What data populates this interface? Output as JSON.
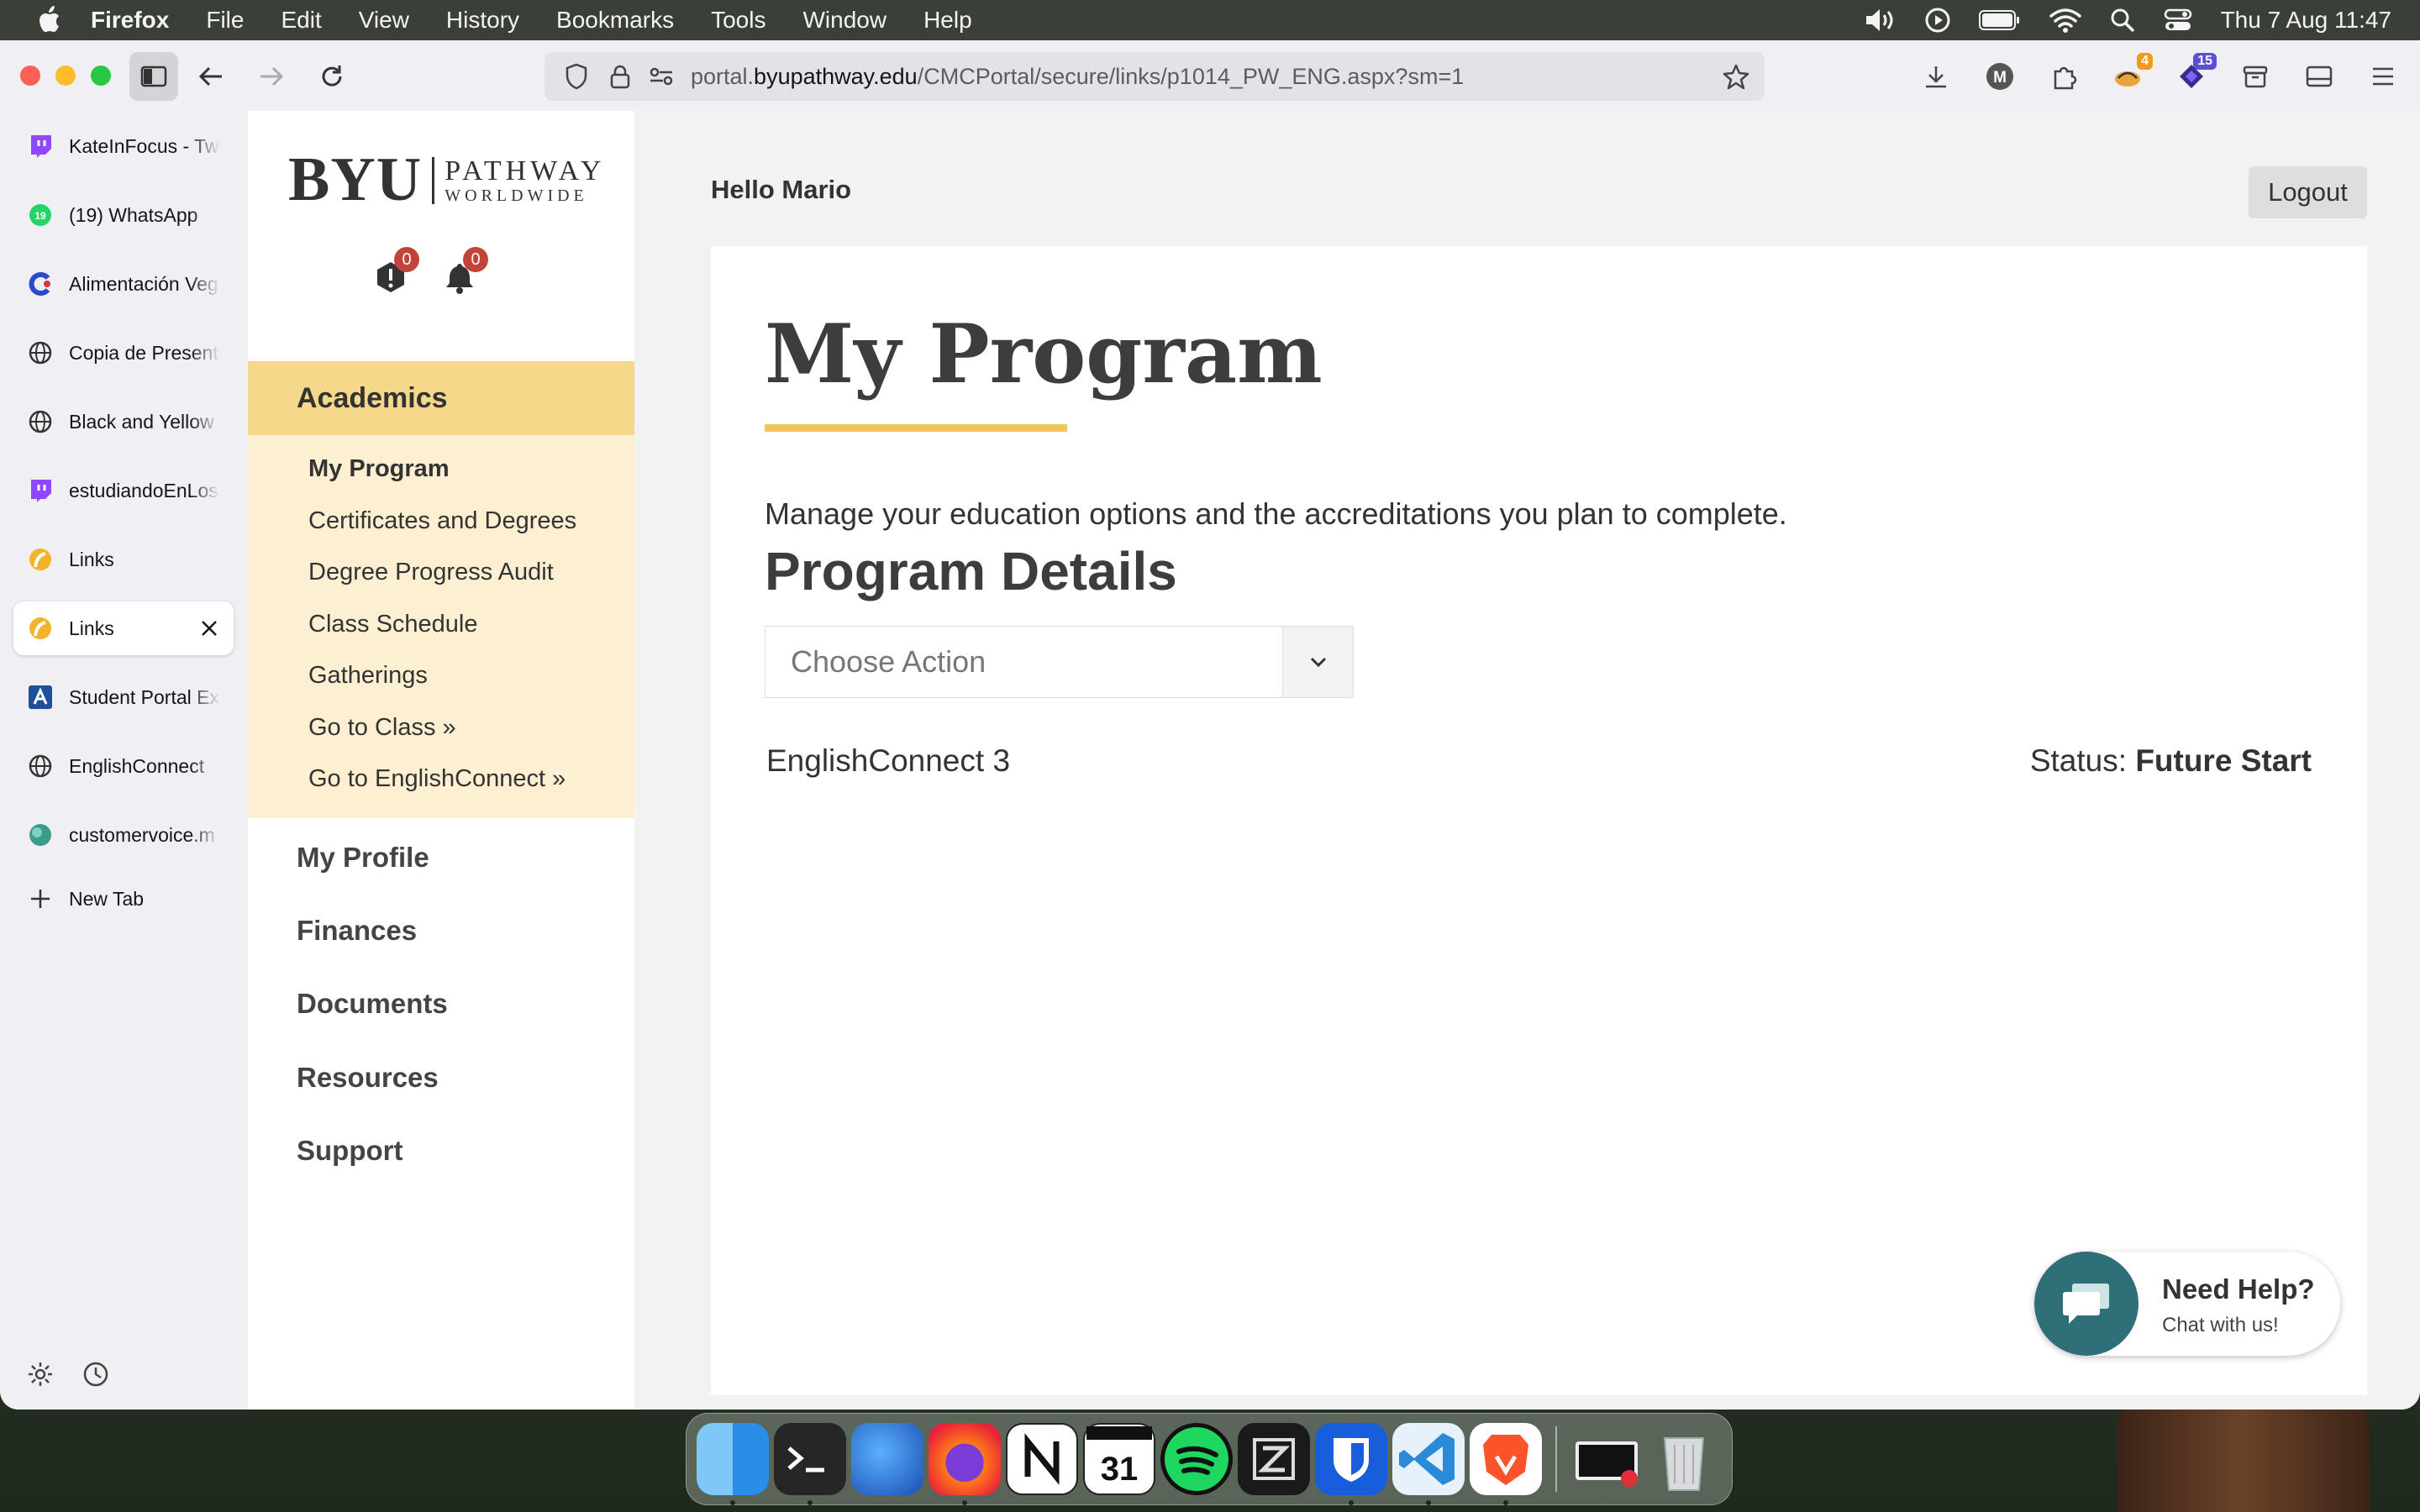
{
  "menubar": {
    "app_name": "Firefox",
    "items": [
      "File",
      "Edit",
      "View",
      "History",
      "Bookmarks",
      "Tools",
      "Window",
      "Help"
    ],
    "clock": "Thu 7 Aug  11:47"
  },
  "browser": {
    "url_prefix": "portal.",
    "url_host": "byupathway.edu",
    "url_path": "/CMCPortal/secure/links/p1014_PW_ENG.aspx?sm=1",
    "badge_extension_1": "4",
    "badge_extension_2": "15",
    "account_initial": "M"
  },
  "tabs": [
    {
      "label": "KateInFocus - Tw",
      "icon": "twitch-icon",
      "color": "#9146ff"
    },
    {
      "label": "(19) WhatsApp",
      "icon": "whatsapp-icon",
      "color": "#25d366",
      "badge": "19"
    },
    {
      "label": "Alimentación Veg",
      "icon": "c-logo-icon",
      "color": "#2b4ac8"
    },
    {
      "label": "Copia de Present",
      "icon": "globe-icon",
      "color": "#333333"
    },
    {
      "label": "Black and Yellow",
      "icon": "globe-icon",
      "color": "#333333"
    },
    {
      "label": "estudiandoEnLos",
      "icon": "twitch-icon",
      "color": "#9146ff"
    },
    {
      "label": "Links",
      "icon": "pathway-icon",
      "color": "#f1b32a"
    },
    {
      "label": "Links",
      "icon": "pathway-icon",
      "color": "#f1b32a",
      "active": true
    },
    {
      "label": "Student Portal Ex",
      "icon": "a-logo-icon",
      "color": "#1f4f9c"
    },
    {
      "label": "EnglishConnect",
      "icon": "globe-icon",
      "color": "#333333"
    },
    {
      "label": "customervoice.m",
      "icon": "customervoice-icon",
      "color": "#3c9b8a"
    }
  ],
  "new_tab_label": "New Tab",
  "portal": {
    "logo_main": "BYU",
    "logo_line1": "PATHWAY",
    "logo_line2": "WORLDWIDE",
    "alerts_count": "0",
    "notifications_count": "0",
    "greeting": "Hello Mario",
    "logout_label": "Logout",
    "nav": {
      "academics": "Academics",
      "academics_items": [
        "My Program",
        "Certificates and Degrees",
        "Degree Progress Audit",
        "Class Schedule",
        "Gatherings",
        "Go to Class »",
        "Go to EnglishConnect »"
      ],
      "my_profile": "My Profile",
      "finances": "Finances",
      "documents": "Documents",
      "resources": "Resources",
      "support": "Support"
    },
    "page_title": "My Program",
    "description": "Manage your education options and the accreditations you plan to complete.",
    "section_title": "Program Details",
    "action_select": {
      "value": "Choose Action"
    },
    "program_name": "EnglishConnect 3",
    "status_label": "Status:",
    "status_value": "Future Start",
    "help_title": "Need Help?",
    "help_subtitle": "Chat with us!",
    "accent_color": "#f1c55d"
  },
  "dock": [
    "finder-icon",
    "terminal-icon",
    "thunderbird-icon",
    "firefox-icon",
    "notion-icon",
    "calendar-icon",
    "spotify-icon",
    "zed-icon",
    "bitwarden-icon",
    "vscode-icon",
    "brave-icon",
    "screen-recorder-icon",
    "trash-icon"
  ],
  "dock_calendar_day": "31"
}
